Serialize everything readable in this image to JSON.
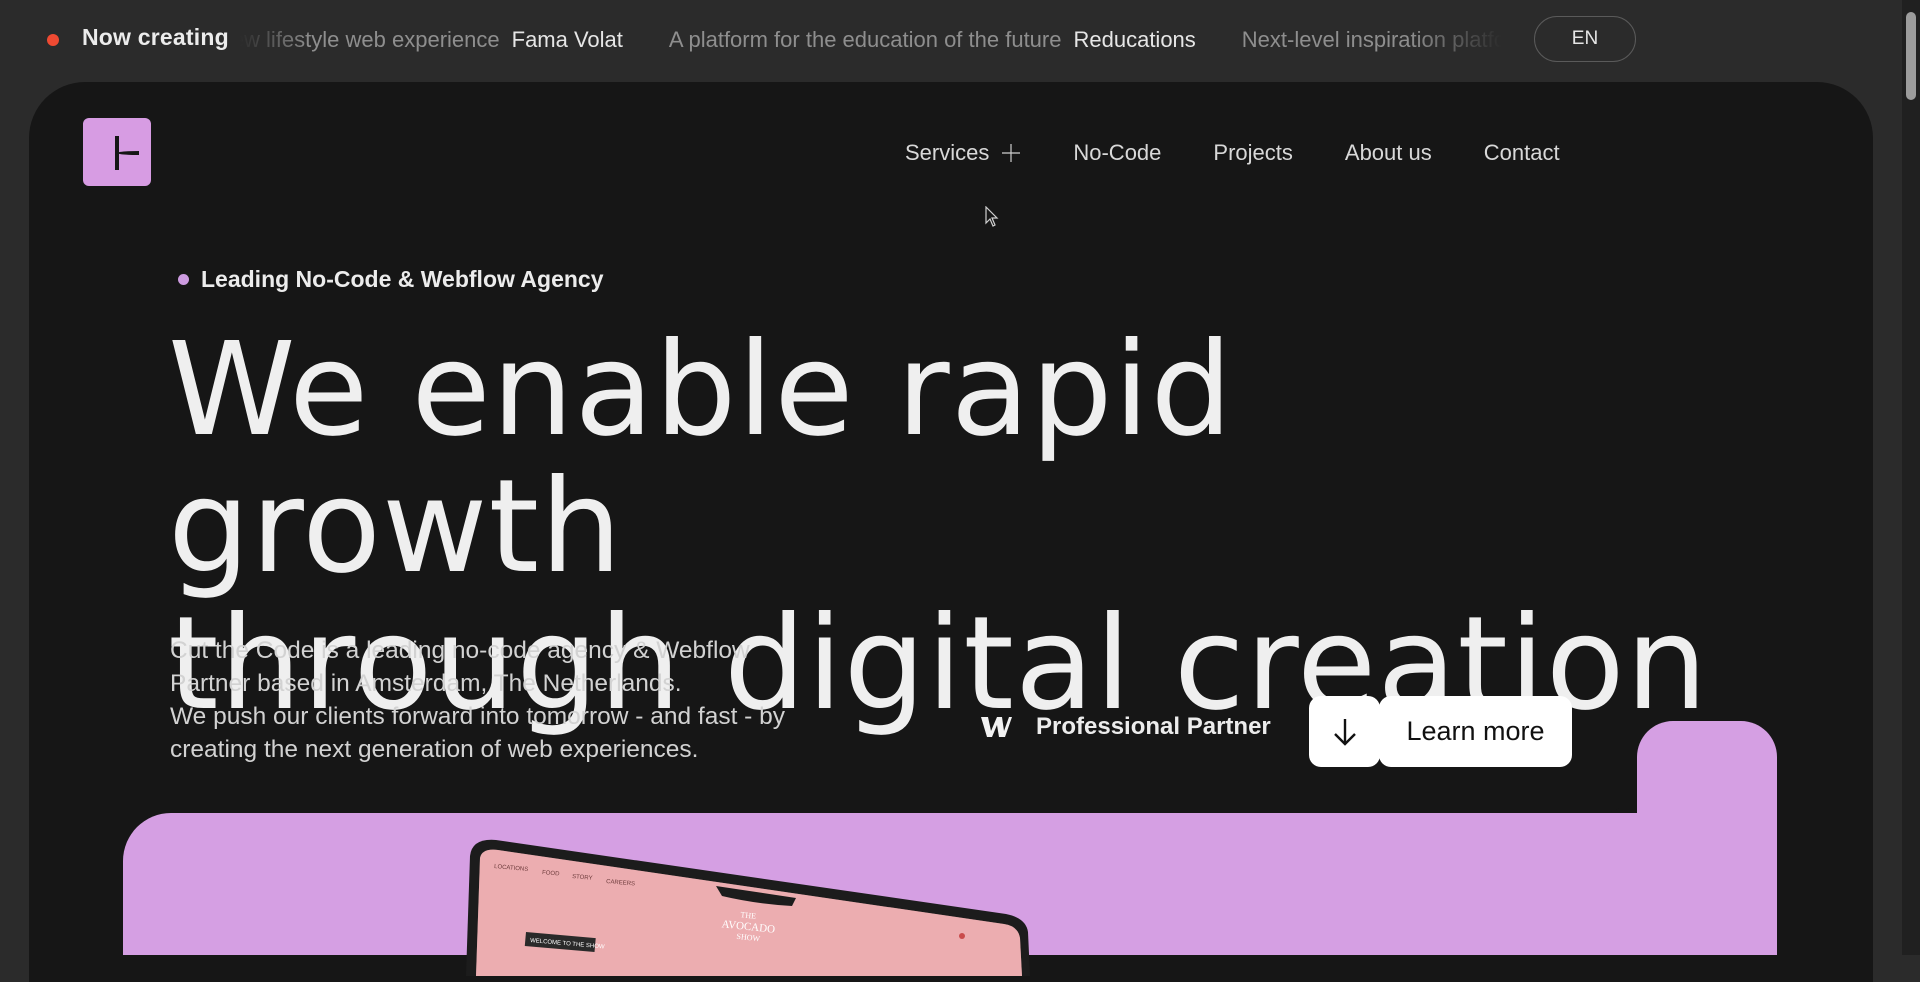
{
  "ticker": {
    "label": "Now creating",
    "items": [
      {
        "description": "A new lifestyle web experience",
        "name": "Fama Volat"
      },
      {
        "description": "A platform for the education of the future",
        "name": "Reducations"
      },
      {
        "description": "Next-level inspiration platform",
        "name": ""
      }
    ]
  },
  "language": {
    "label": "EN"
  },
  "nav": {
    "services": "Services",
    "nocode": "No-Code",
    "projects": "Projects",
    "about": "About us",
    "contact": "Contact"
  },
  "hero": {
    "eyebrow": "Leading No-Code & Webflow Agency",
    "title_line1": "We enable rapid growth",
    "title_line2": "through digital creation",
    "description_1": "Cut the Code is a leading no-code agency & Webflow Partner based in Amsterdam, The Netherlands.",
    "description_2": "We push our clients forward into tomorrow - and fast - by creating the next generation of web experiences."
  },
  "partner": {
    "label": "Professional Partner"
  },
  "cta": {
    "learn_more": "Learn more"
  },
  "showcase": {
    "nav": [
      "LOCATIONS",
      "FOOD",
      "STORY",
      "CAREERS"
    ],
    "brand_1": "THE",
    "brand_2": "AVOCADO",
    "brand_3": "SHOW",
    "welcome": "WELCOME TO THE SHOW"
  },
  "colors": {
    "accent_lavender": "#d59fe3",
    "live_dot": "#ef4a32",
    "panel": "#161616",
    "page": "#2b2b2b"
  },
  "icons": {
    "ticker_dot": "live-dot-icon",
    "services_toggle": "plus-icon",
    "partner": "webflow-w-icon",
    "cta": "arrow-down-icon"
  }
}
